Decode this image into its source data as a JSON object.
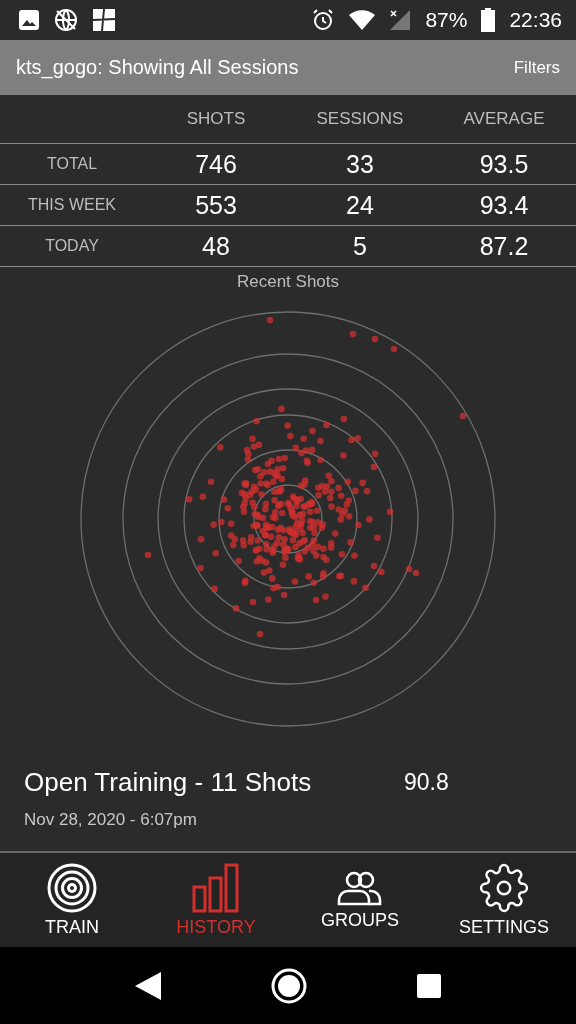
{
  "status_bar": {
    "battery": "87%",
    "time": "22:36"
  },
  "header": {
    "title": "kts_gogo: Showing All Sessions",
    "action": "Filters"
  },
  "stats": {
    "columns": [
      "SHOTS",
      "SESSIONS",
      "AVERAGE"
    ],
    "rows": [
      {
        "label": "TOTAL",
        "values": [
          "746",
          "33",
          "93.5"
        ]
      },
      {
        "label": "THIS WEEK",
        "values": [
          "553",
          "24",
          "93.4"
        ]
      },
      {
        "label": "TODAY",
        "values": [
          "48",
          "5",
          "87.2"
        ]
      }
    ]
  },
  "chart_title": "Recent Shots",
  "session": {
    "title": "Open Training - 11 Shots",
    "score": "90.8",
    "date": "Nov 28, 2020 - 6:07pm"
  },
  "nav": [
    {
      "label": "TRAIN",
      "kind": "target",
      "selected": false
    },
    {
      "label": "HISTORY",
      "kind": "bars",
      "selected": true
    },
    {
      "label": "GROUPS",
      "kind": "people",
      "selected": false
    },
    {
      "label": "SETTINGS",
      "kind": "gear",
      "selected": false
    }
  ]
}
